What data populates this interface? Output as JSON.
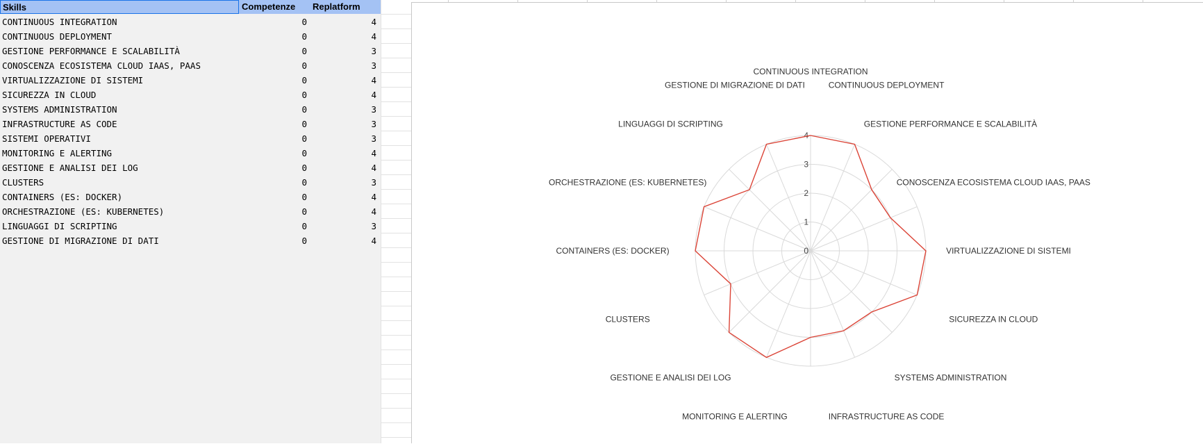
{
  "sheet": {
    "headers": {
      "skills": "Skills",
      "competenze": "Competenze",
      "replatform": "Replatform"
    },
    "rows": [
      {
        "skill": "CONTINUOUS INTEGRATION",
        "competenze": "0",
        "replatform": "4"
      },
      {
        "skill": "CONTINUOUS DEPLOYMENT",
        "competenze": "0",
        "replatform": "4"
      },
      {
        "skill": "GESTIONE PERFORMANCE E SCALABILITÀ",
        "competenze": "0",
        "replatform": "3"
      },
      {
        "skill": "CONOSCENZA ECOSISTEMA CLOUD IAAS, PAAS",
        "competenze": "0",
        "replatform": "3"
      },
      {
        "skill": "VIRTUALIZZAZIONE DI SISTEMI",
        "competenze": "0",
        "replatform": "4"
      },
      {
        "skill": "SICUREZZA IN CLOUD",
        "competenze": "0",
        "replatform": "4"
      },
      {
        "skill": "SYSTEMS ADMINISTRATION",
        "competenze": "0",
        "replatform": "3"
      },
      {
        "skill": "INFRASTRUCTURE AS CODE",
        "competenze": "0",
        "replatform": "3"
      },
      {
        "skill": "SISTEMI OPERATIVI",
        "competenze": "0",
        "replatform": "3"
      },
      {
        "skill": "MONITORING E ALERTING",
        "competenze": "0",
        "replatform": "4"
      },
      {
        "skill": "GESTIONE E ANALISI DEI LOG",
        "competenze": "0",
        "replatform": "4"
      },
      {
        "skill": "CLUSTERS",
        "competenze": "0",
        "replatform": "3"
      },
      {
        "skill": "CONTAINERS (ES: DOCKER)",
        "competenze": "0",
        "replatform": "4"
      },
      {
        "skill": "ORCHESTRAZIONE (ES: KUBERNETES)",
        "competenze": "0",
        "replatform": "4"
      },
      {
        "skill": "LINGUAGGI DI SCRIPTING",
        "competenze": "0",
        "replatform": "3"
      },
      {
        "skill": "GESTIONE DI MIGRAZIONE DI DATI",
        "competenze": "0",
        "replatform": "4"
      }
    ]
  },
  "chart_data": {
    "type": "radar",
    "categories": [
      "CONTINUOUS INTEGRATION",
      "CONTINUOUS DEPLOYMENT",
      "GESTIONE PERFORMANCE E SCALABILITÀ",
      "CONOSCENZA ECOSISTEMA CLOUD IAAS, PAAS",
      "VIRTUALIZZAZIONE DI SISTEMI",
      "SICUREZZA IN CLOUD",
      "SYSTEMS ADMINISTRATION",
      "INFRASTRUCTURE AS CODE",
      "SISTEMI OPERATIVI",
      "MONITORING E ALERTING",
      "GESTIONE E ANALISI DEI LOG",
      "CLUSTERS",
      "CONTAINERS (ES: DOCKER)",
      "ORCHESTRAZIONE (ES: KUBERNETES)",
      "LINGUAGGI DI SCRIPTING",
      "GESTIONE DI MIGRAZIONE DI DATI"
    ],
    "visible_labels": [
      true,
      true,
      true,
      true,
      true,
      true,
      true,
      true,
      false,
      true,
      true,
      true,
      true,
      true,
      true,
      true
    ],
    "series": [
      {
        "values": [
          0,
          0,
          0,
          0,
          0,
          0,
          0,
          0,
          0,
          0,
          0,
          0,
          0,
          0,
          0,
          0
        ],
        "color": "#4285f4"
      },
      {
        "values": [
          4,
          4,
          3,
          3,
          4,
          4,
          3,
          3,
          3,
          4,
          4,
          3,
          4,
          4,
          3,
          4
        ],
        "color": "#db4437"
      }
    ],
    "ticks": [
      "0",
      "1",
      "2",
      "3",
      "4"
    ],
    "rmax": 4,
    "grid": true,
    "legend": "none"
  },
  "colors": {
    "header_bg": "#a4c2f4",
    "sheet_bg": "#f1f1f1",
    "grid_line": "#d9d9d9",
    "series_line": "#db4437"
  }
}
